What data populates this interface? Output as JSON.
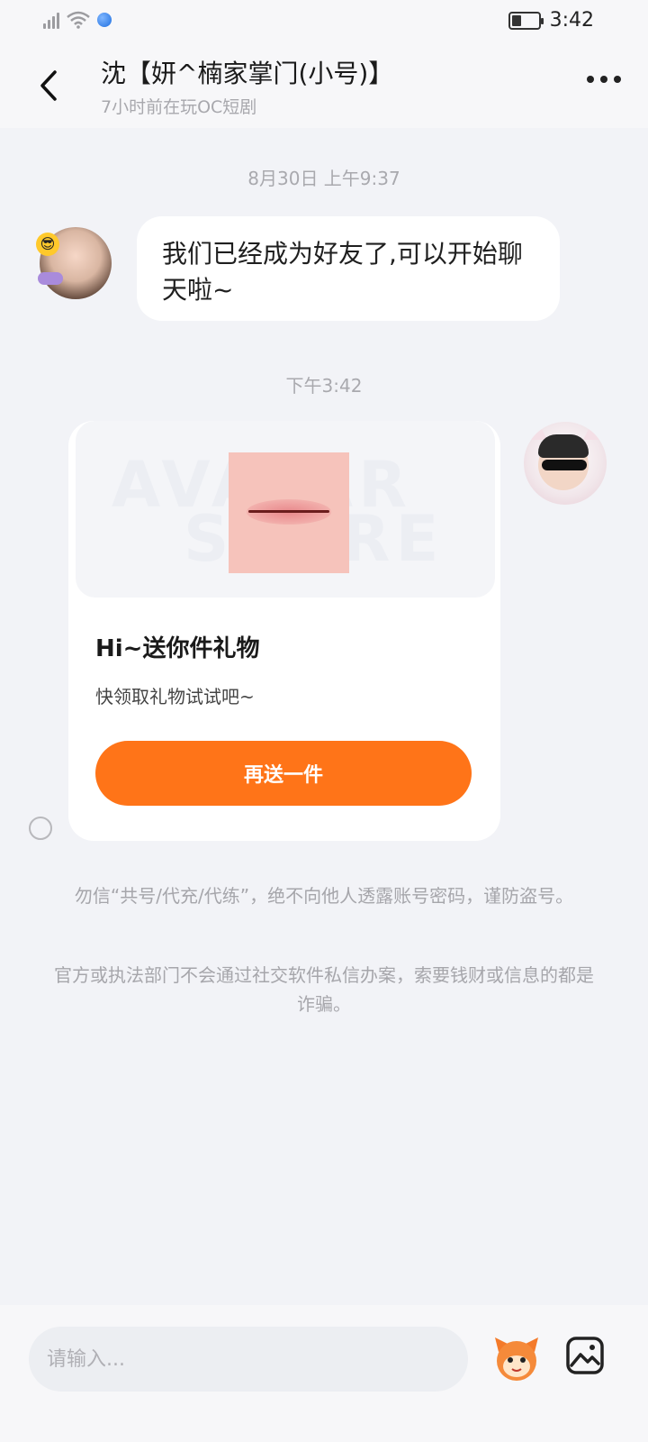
{
  "status_bar": {
    "time": "3:42"
  },
  "header": {
    "title": "沈【妍^楠家掌门(小号)】",
    "subtitle": "7小时前在玩OC短剧"
  },
  "chat": {
    "timestamp_1": "8月30日 上午9:37",
    "message_1": "我们已经成为好友了,可以开始聊天啦~",
    "timestamp_2": "下午3:42",
    "gift_card": {
      "watermark_line1": "AVATAR",
      "watermark_line2": "STORE",
      "title": "Hi~送你件礼物",
      "subtitle": "快领取礼物试试吧~",
      "button_label": "再送一件"
    }
  },
  "notices": {
    "notice_1": "勿信“共号/代充/代练”，绝不向他人透露账号密码，谨防盗号。",
    "notice_2": "官方或执法部门不会通过社交软件私信办案，索要钱财或信息的都是诈骗。"
  },
  "input": {
    "placeholder": "请输入..."
  },
  "colors": {
    "accent": "#ff7418",
    "background": "#f2f3f7",
    "bubble": "#ffffff"
  }
}
